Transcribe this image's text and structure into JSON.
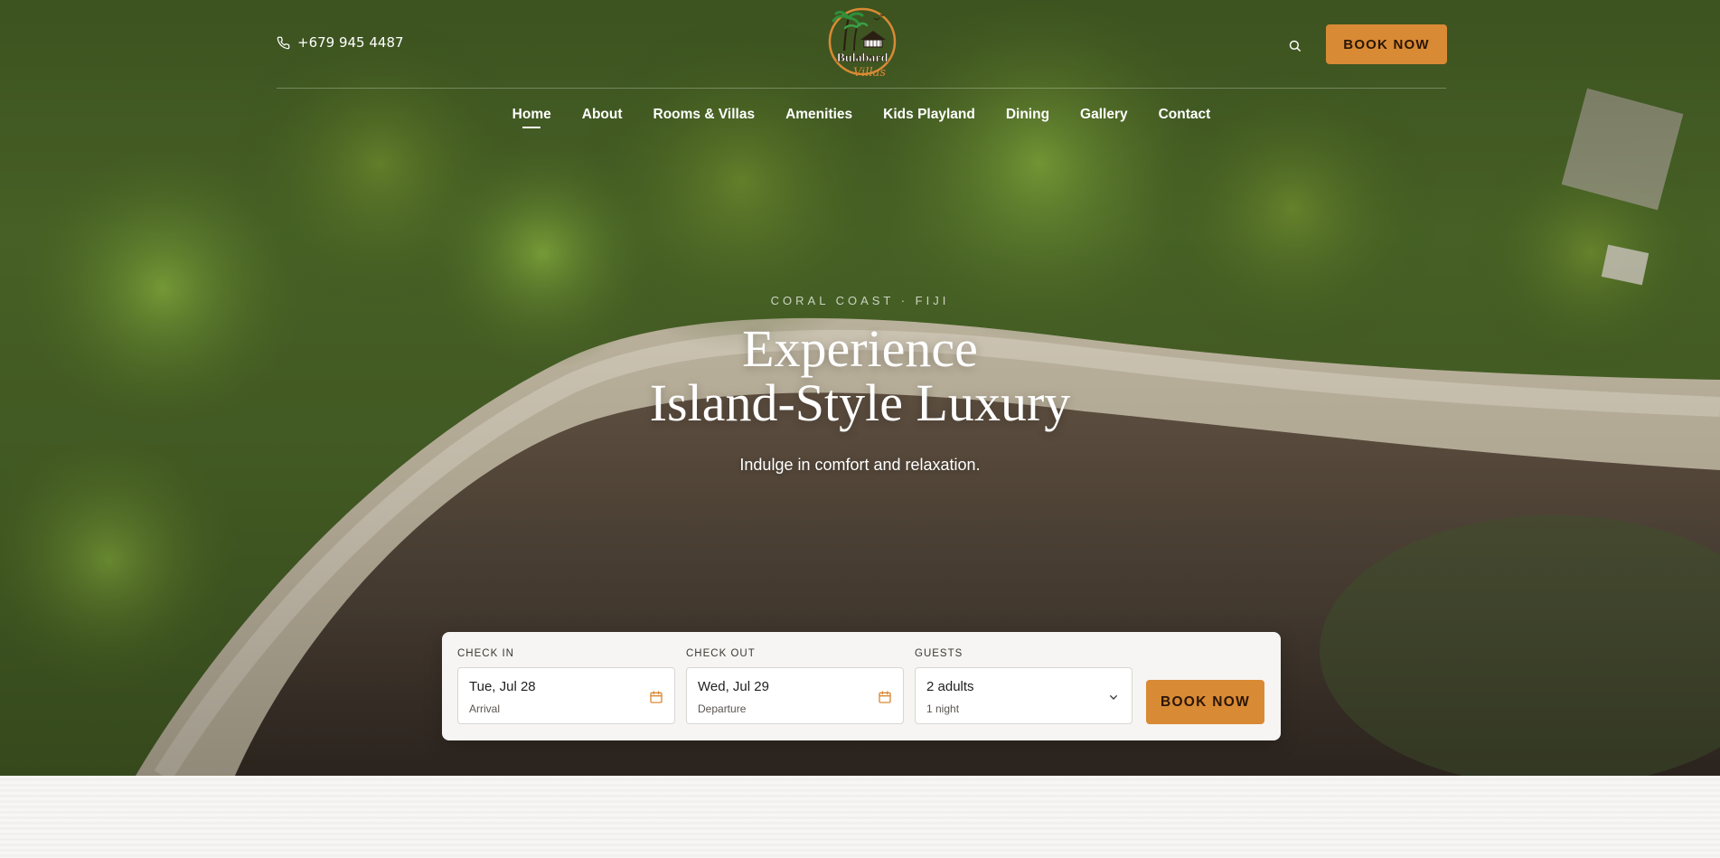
{
  "header": {
    "phone": "+679 945 4487",
    "logo_text": "Bulabard",
    "logo_script": "Villas",
    "book_label": "BOOK NOW"
  },
  "nav": {
    "items": [
      {
        "label": "Home",
        "active": true
      },
      {
        "label": "About"
      },
      {
        "label": "Rooms & Villas"
      },
      {
        "label": "Amenities"
      },
      {
        "label": "Kids Playland"
      },
      {
        "label": "Dining"
      },
      {
        "label": "Gallery"
      },
      {
        "label": "Contact"
      }
    ]
  },
  "hero": {
    "eyebrow": "CORAL COAST · FIJI",
    "headline_line1": "Experience",
    "headline_line2": "Island-Style Luxury",
    "subline": "Indulge in comfort and relaxation."
  },
  "booking": {
    "checkin_label": "CHECK IN",
    "checkin_value": "Tue, Jul 28",
    "checkin_sub": "Arrival",
    "checkout_label": "CHECK OUT",
    "checkout_value": "Wed, Jul 29",
    "checkout_sub": "Departure",
    "guests_label": "GUESTS",
    "guests_value": "2 adults",
    "guests_sub": "1 night",
    "book_label": "BOOK NOW"
  },
  "colors": {
    "accent": "#d98a34",
    "accent_text": "#2a1606",
    "card_bg": "#f6f5f3"
  },
  "icons": [
    "phone-icon",
    "search-icon",
    "calendar-icon",
    "chevron-down-icon"
  ]
}
